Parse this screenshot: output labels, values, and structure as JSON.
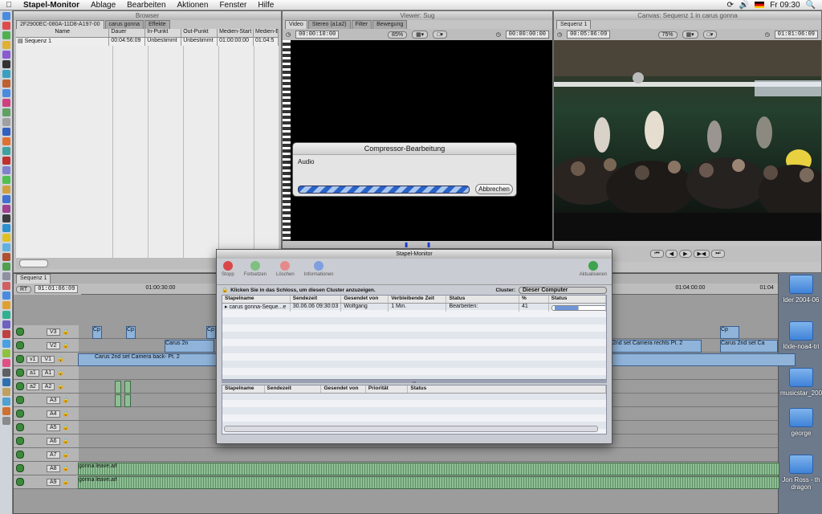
{
  "menubar": {
    "app": "Stapel-Monitor",
    "items": [
      "Ablage",
      "Bearbeiten",
      "Aktionen",
      "Fenster",
      "Hilfe"
    ],
    "clock": "Fr 09:30"
  },
  "browser": {
    "title": "Browser",
    "tabs": [
      "2F2900EC-080A-11D8-A197-00",
      "carus gonna",
      "Effekte"
    ],
    "headers": [
      "Name",
      "Dauer",
      "In-Punkt",
      "Out-Punkt",
      "Medien-Start",
      "Medien-End"
    ],
    "rows": [
      [
        "Sequenz 1",
        "00:04:56:09",
        "Unbestimmt",
        "Unbestimmt",
        "01:00:00:00",
        "01:04:5"
      ]
    ]
  },
  "viewer": {
    "title": "Viewer: Sug",
    "tabs": [
      "Video",
      "Stereo (a1a2)",
      "Filter",
      "Bewegung"
    ],
    "timecode_left": "00:00:10:00",
    "zoom": "85%",
    "timecode_right": "00:00:00:00"
  },
  "canvas": {
    "title": "Canvas: Sequenz 1 in carus gonna",
    "tab": "Sequenz 1",
    "timecode_left": "00:05:06:09",
    "zoom": "75%",
    "timecode_right": "01:01:06:09"
  },
  "compressor": {
    "title": "Compressor-Bearbeitung",
    "label": "Audio",
    "progress": 1.0,
    "cancel": "Abbrechen"
  },
  "stapel": {
    "title": "Stapel-Monitor",
    "toolbar": [
      "Stopp",
      "Fortsetzen",
      "Löschen",
      "Informationen"
    ],
    "refresh": "Aktualisieren",
    "hint": "Klicken Sie in das Schloss, um diesen Cluster anzuzeigen.",
    "cluster_label": "Cluster:",
    "cluster_value": "Dieser Computer",
    "top_headers": [
      "Stapelname",
      "Sendezeit",
      "Gesendet von",
      "Verbleibende Zeit",
      "Status",
      "%",
      "Status"
    ],
    "top_row": [
      "carus gonna-Seque...e",
      "30.06.06 09:30:03",
      "Wolfgang",
      "1 Min.",
      "Bearbeiten:",
      "41"
    ],
    "top_row_progress": 0.41,
    "bottom_headers": [
      "Stapelname",
      "Sendezeit",
      "Gesendet von",
      "Priorität",
      "Status"
    ]
  },
  "timeline": {
    "tab": "Sequenz 1",
    "rt": "RT",
    "timecode": "01:01:06:09",
    "ruler": [
      "01:00:30:00",
      "01:04:00:00",
      "01:04"
    ],
    "tracks": [
      "V3",
      "V2",
      "V1",
      "A1",
      "A2",
      "A3",
      "A4",
      "A5",
      "A6",
      "A7",
      "A8",
      "A9"
    ],
    "src_labels": [
      "v1",
      "a1",
      "a2"
    ],
    "clips": {
      "v2_left": "Carus 2n",
      "v2_right_a": "2nd set Camera rechts Pt. 2",
      "v2_right_b": "Carus 2nd set Ca",
      "v1": "Carus 2nd set Camera back- Pt. 2",
      "a8": "gonna leave.aif",
      "a9": "gonna leave.aif",
      "cp": "Cp"
    }
  },
  "desktop": {
    "icons": [
      "lder 2004-06",
      "löde-noa4-tri",
      "musicstar_2005",
      "george",
      "Jon Ross - th dragon"
    ]
  }
}
